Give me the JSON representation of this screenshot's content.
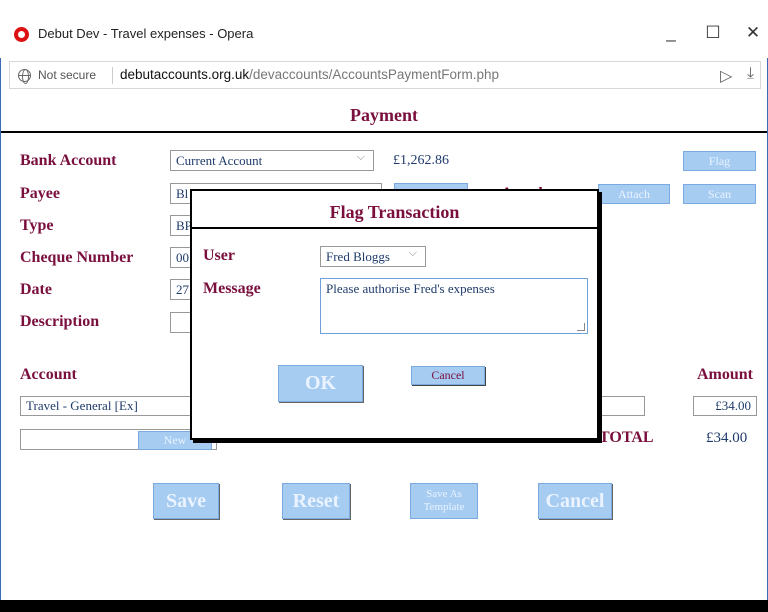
{
  "window": {
    "title": "Debut Dev - Travel expenses - Opera",
    "minimize": "_",
    "maximize": "☐",
    "close": "✕"
  },
  "address": {
    "security": "Not secure",
    "domain": "debutaccounts.org.uk",
    "path": "/devaccounts/AccountsPaymentForm.php",
    "send_glyph": "▷",
    "download_glyph": "⤓"
  },
  "page": {
    "title": "Payment",
    "labels": {
      "bank_account": "Bank Account",
      "payee": "Payee",
      "type": "Type",
      "cheque_number": "Cheque Number",
      "date": "Date",
      "description": "Description",
      "attach_partial": "Attach",
      "account": "Account",
      "amount": "Amount",
      "total": "TOTAL"
    },
    "values": {
      "bank_account": "Current Account",
      "balance": "£1,262.86",
      "payee_partial": "Bl",
      "type_partial": "BP",
      "cheque_partial": "00",
      "date_partial": "27",
      "line_account": "Travel - General [Ex]",
      "line_amount": "£34.00",
      "total": "£34.00"
    },
    "buttons": {
      "flag": "Flag",
      "attach": "Attach",
      "scan": "Scan",
      "new": "New",
      "save": "Save",
      "reset": "Reset",
      "save_as_template": "Save As Template",
      "cancel": "Cancel"
    }
  },
  "dialog": {
    "title": "Flag Transaction",
    "user_label": "User",
    "user_value": "Fred Bloggs",
    "message_label": "Message",
    "message_value": "Please authorise Fred's expenses",
    "ok": "OK",
    "cancel": "Cancel"
  },
  "colors": {
    "label": "#7a0f3d",
    "value": "#1f3b6b",
    "button_fill": "#a6ccf2"
  }
}
